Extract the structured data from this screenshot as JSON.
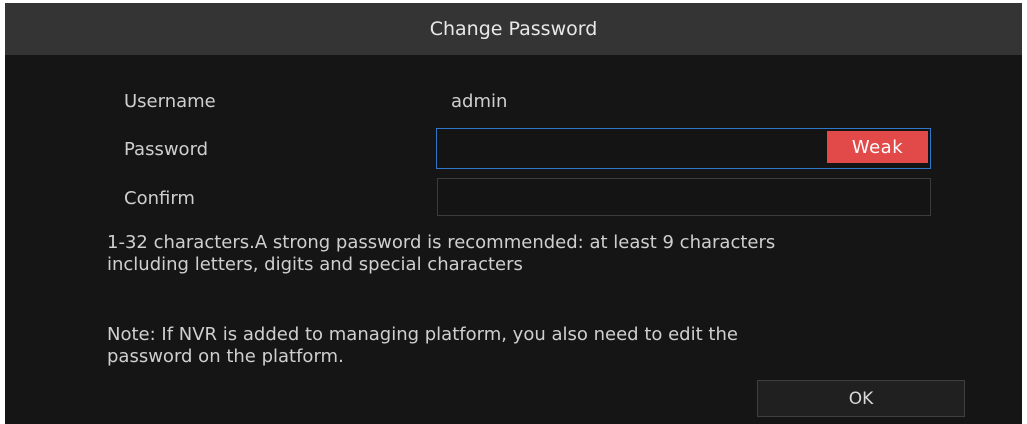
{
  "dialog": {
    "title": "Change Password"
  },
  "form": {
    "username_label": "Username",
    "username_value": "admin",
    "password_label": "Password",
    "password_value": "",
    "password_strength": "Weak",
    "confirm_label": "Confirm",
    "confirm_value": ""
  },
  "hints": {
    "requirements": "1-32 characters.A strong password is recommended: at least 9 characters\nincluding letters, digits and special characters",
    "note": "Note: If NVR is added to managing platform, you also need to edit the\npassword on the platform."
  },
  "actions": {
    "ok_label": "OK"
  },
  "colors": {
    "background": "#151515",
    "title_bar": "#343434",
    "focus_border": "#2f77c9",
    "weak_badge": "#e24a4a"
  }
}
